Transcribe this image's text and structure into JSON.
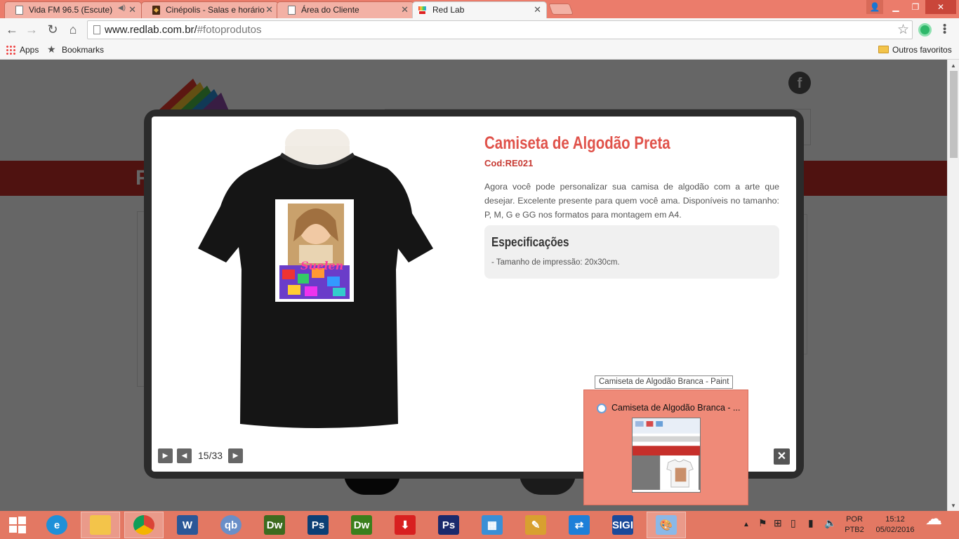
{
  "browser": {
    "tabs": [
      {
        "label": "Vida FM 96.5 (Escute)",
        "active": false,
        "icon": "page-icon"
      },
      {
        "label": "Cinépolis - Salas e horário",
        "active": false,
        "icon": "cinepolis-icon"
      },
      {
        "label": "Área do Cliente",
        "active": false,
        "icon": "page-icon"
      },
      {
        "label": "Red Lab",
        "active": true,
        "icon": "redlab-icon"
      }
    ],
    "url_domain": "www.redlab.com.br/",
    "url_path": "#fotoprodutos",
    "bookmarks": {
      "apps": "Apps",
      "bookmarks": "Bookmarks",
      "other": "Outros favoritos"
    }
  },
  "lightbox": {
    "title": "Camiseta de Algodão Preta",
    "code": "Cod:RE021",
    "description": "Agora você pode personalizar sua camisa de algodão com a arte que desejar. Excelente presente para quem você ama. Disponíveis no tamanho: P, M, G e GG nos formatos para montagem em A4.",
    "spec_heading": "Especificações",
    "spec_text": "- Tamanho de impressão: 20x30cm.",
    "counter": "15/33",
    "shirt_print_text": "Suelen"
  },
  "page_bg": {
    "band_text": "FO"
  },
  "taskbar_preview": {
    "tooltip": "Camiseta de Algodão Branca - Paint",
    "title": "Camiseta de Algodão Branca - ..."
  },
  "taskbar": {
    "apps": [
      {
        "name": "internet-explorer-icon",
        "label": "e",
        "color": "#1e90d8"
      },
      {
        "name": "file-explorer-icon",
        "label": "",
        "color": "#f3c44a"
      },
      {
        "name": "chrome-icon",
        "label": "",
        "color": "#ffffff"
      },
      {
        "name": "word-icon",
        "label": "W",
        "color": "#2b5797"
      },
      {
        "name": "qb-icon",
        "label": "qb",
        "color": "#6a8fc8"
      },
      {
        "name": "dreamweaver-icon",
        "label": "Dw",
        "color": "#3d6b1f"
      },
      {
        "name": "photoshop-icon",
        "label": "Ps",
        "color": "#0c3f75"
      },
      {
        "name": "dreamweaver-2-icon",
        "label": "Dw",
        "color": "#3b7f1c"
      },
      {
        "name": "download-icon",
        "label": "⬇",
        "color": "#d82020"
      },
      {
        "name": "photoshop-2-icon",
        "label": "Ps",
        "color": "#1a2a6c"
      },
      {
        "name": "network-icon",
        "label": "▦",
        "color": "#3a8fd6"
      },
      {
        "name": "tool-icon",
        "label": "✎",
        "color": "#d8a030"
      },
      {
        "name": "teamviewer-icon",
        "label": "⇄",
        "color": "#1e7fd8"
      },
      {
        "name": "sigi-icon",
        "label": "SIGI",
        "color": "#1a4a9a"
      },
      {
        "name": "paint-icon",
        "label": "🎨",
        "color": "#8ab8e8"
      }
    ],
    "lang_top": "POR",
    "lang_bottom": "PTB2",
    "time": "15:12",
    "date": "05/02/2016"
  }
}
